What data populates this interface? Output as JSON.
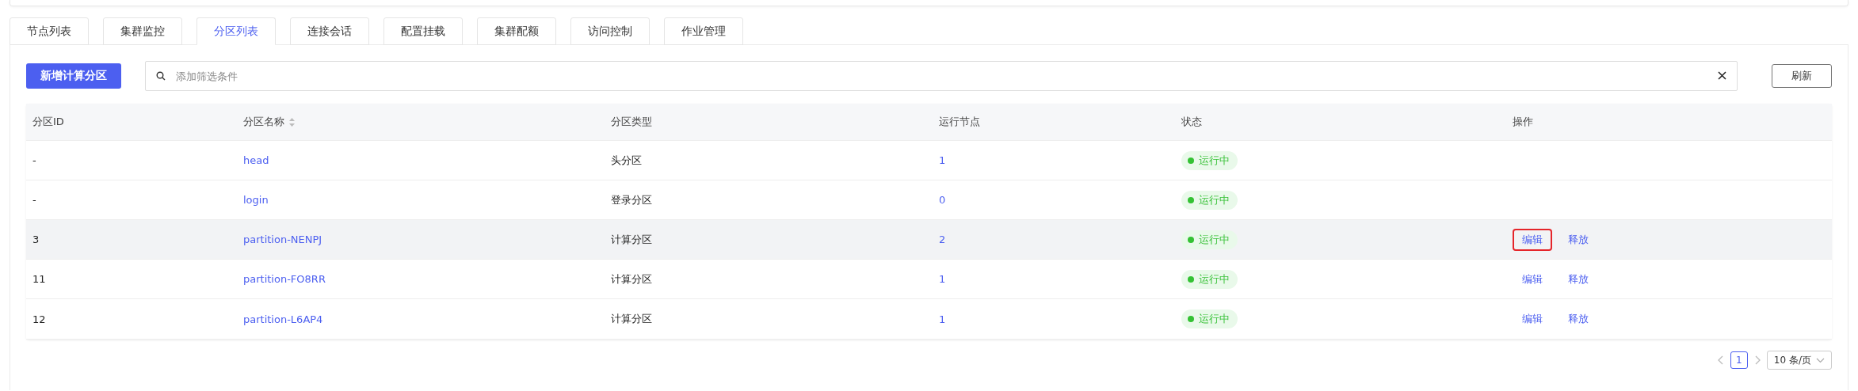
{
  "tabs": [
    {
      "label": "节点列表",
      "selected": false
    },
    {
      "label": "集群监控",
      "selected": false
    },
    {
      "label": "分区列表",
      "selected": true
    },
    {
      "label": "连接会话",
      "selected": false
    },
    {
      "label": "配置挂载",
      "selected": false
    },
    {
      "label": "集群配额",
      "selected": false
    },
    {
      "label": "访问控制",
      "selected": false
    },
    {
      "label": "作业管理",
      "selected": false
    }
  ],
  "toolbar": {
    "add_button": "新增计算分区",
    "search": {
      "placeholder": "添加筛选条件"
    },
    "refresh_button": "刷新"
  },
  "table": {
    "columns": [
      {
        "label": "分区ID",
        "sortable": false
      },
      {
        "label": "分区名称",
        "sortable": true
      },
      {
        "label": "分区类型",
        "sortable": false
      },
      {
        "label": "运行节点",
        "sortable": false
      },
      {
        "label": "状态",
        "sortable": false
      },
      {
        "label": "操作",
        "sortable": false
      }
    ],
    "rows": [
      {
        "id": "-",
        "name": "head",
        "type": "头分区",
        "nodes": "1",
        "status": "运行中",
        "hovered": false,
        "actions": []
      },
      {
        "id": "-",
        "name": "login",
        "type": "登录分区",
        "nodes": "0",
        "status": "运行中",
        "hovered": false,
        "actions": []
      },
      {
        "id": "3",
        "name": "partition-NENPJ",
        "type": "计算分区",
        "nodes": "2",
        "status": "运行中",
        "hovered": true,
        "actions": [
          {
            "label": "编辑",
            "outlined": true
          },
          {
            "label": "释放",
            "outlined": false
          }
        ]
      },
      {
        "id": "11",
        "name": "partition-FO8RR",
        "type": "计算分区",
        "nodes": "1",
        "status": "运行中",
        "hovered": false,
        "actions": [
          {
            "label": "编辑",
            "outlined": false
          },
          {
            "label": "释放",
            "outlined": false
          }
        ]
      },
      {
        "id": "12",
        "name": "partition-L6AP4",
        "type": "计算分区",
        "nodes": "1",
        "status": "运行中",
        "hovered": false,
        "actions": [
          {
            "label": "编辑",
            "outlined": false
          },
          {
            "label": "释放",
            "outlined": false
          }
        ]
      }
    ]
  },
  "pagination": {
    "pages": [
      {
        "label": "1",
        "selected": true
      }
    ],
    "page_size": "10 条/页"
  }
}
